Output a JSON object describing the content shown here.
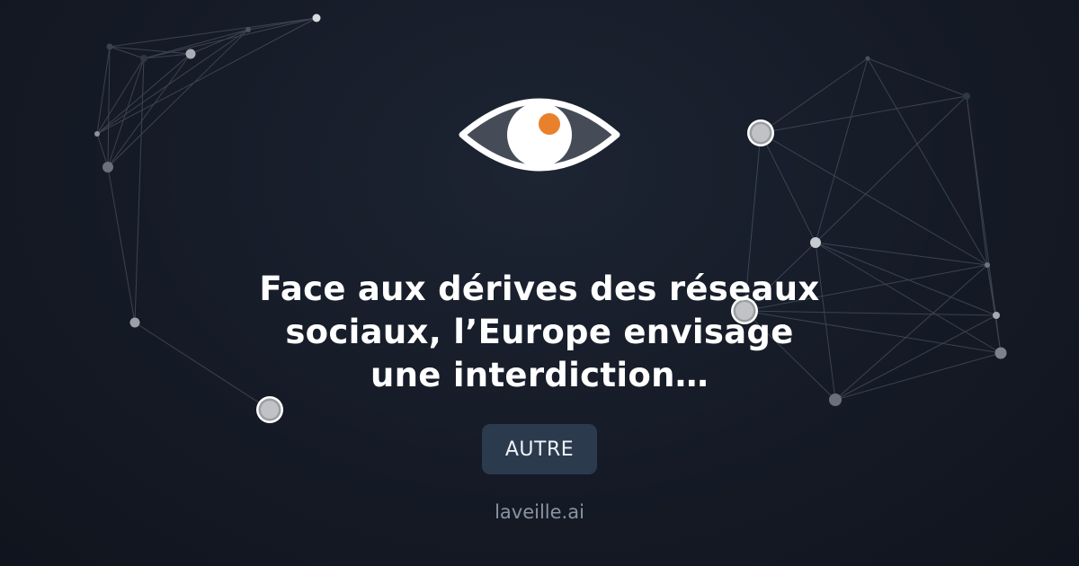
{
  "headline": "Face aux dérives des réseaux sociaux, l’Europe envisage une interdiction…",
  "category": "AUTRE",
  "site": "laveille.ai",
  "logo": {
    "icon": "eye-icon",
    "iris_color": "#e8812b",
    "outline_color": "#ffffff"
  },
  "colors": {
    "background": "#161c28",
    "badge": "#2c3a4d",
    "domain_text": "#8a93a1",
    "network_lines": "#5a6473"
  }
}
